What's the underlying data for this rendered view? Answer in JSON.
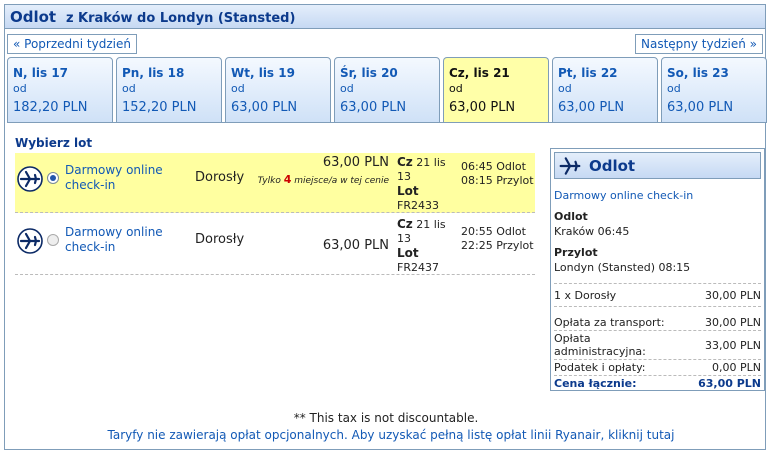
{
  "header": {
    "title": "Odlot",
    "route": "z Kraków do Londyn (Stansted)"
  },
  "nav": {
    "prev": "« Poprzedni tydzień",
    "next": "Następny tydzień »"
  },
  "tabs": [
    {
      "date": "N, lis 17",
      "from": "od",
      "price": "182,20 PLN"
    },
    {
      "date": "Pn, lis 18",
      "from": "od",
      "price": "152,20 PLN"
    },
    {
      "date": "Wt, lis 19",
      "from": "od",
      "price": "63,00 PLN"
    },
    {
      "date": "Śr, lis 20",
      "from": "od",
      "price": "63,00 PLN"
    },
    {
      "date": "Cz, lis 21",
      "from": "od",
      "price": "63,00 PLN"
    },
    {
      "date": "Pt, lis 22",
      "from": "od",
      "price": "63,00 PLN"
    },
    {
      "date": "So, lis 23",
      "from": "od",
      "price": "63,00 PLN"
    }
  ],
  "select_title": "Wybierz lot",
  "flights": [
    {
      "fare": "Darmowy online check-in",
      "pax": "Dorosły",
      "price": "63,00 PLN",
      "seats_pre": "Tylko",
      "seats_num": "4",
      "seats_post": "miejsce/a w tej cenie",
      "day": "Cz",
      "date": "21 lis 13",
      "lot": "Lot",
      "flight_no": "FR2433",
      "dep": "06:45 Odlot",
      "arr": "08:15 Przylot"
    },
    {
      "fare": "Darmowy online check-in",
      "pax": "Dorosły",
      "price": "63,00 PLN",
      "day": "Cz",
      "date": "21 lis 13",
      "lot": "Lot",
      "flight_no": "FR2437",
      "dep": "20:55 Odlot",
      "arr": "22:25 Przylot"
    }
  ],
  "summary": {
    "title": "Odlot",
    "fare": "Darmowy online check-in",
    "dep_label": "Odlot",
    "dep_value": "Kraków 06:45",
    "arr_label": "Przylot",
    "arr_value": "Londyn (Stansted) 08:15",
    "lines": [
      {
        "label": "1 x Dorosły",
        "value": "30,00 PLN"
      },
      {
        "label": "Opłata za transport:",
        "value": "30,00 PLN"
      },
      {
        "label": "Opłata administracyjna:",
        "value": "33,00 PLN"
      },
      {
        "label": "Podatek i opłaty:",
        "value": "0,00 PLN"
      }
    ],
    "total_label": "Cena łącznie:",
    "total_value": "63,00 PLN"
  },
  "footer": {
    "note": "** This tax is not discountable.",
    "link": "Taryfy nie zawierają opłat opcjonalnych. Aby uzyskać pełną listę opłat linii Ryanair, kliknij tutaj"
  },
  "colors": {
    "accent": "#0c3a8c",
    "link": "#1259b5",
    "highlight": "#ffffa0",
    "warning": "#cc0000"
  },
  "icons": {
    "flight": "airplane-icon"
  }
}
